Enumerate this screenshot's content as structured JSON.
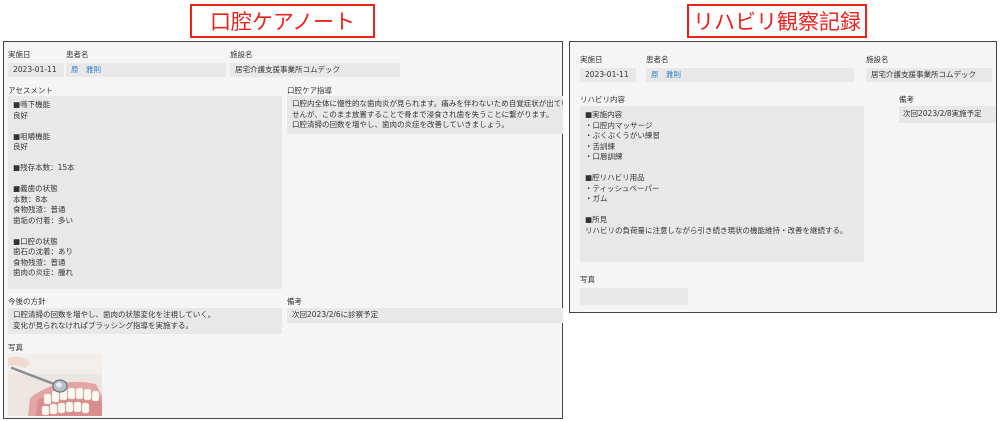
{
  "left": {
    "title": "口腔ケアノート",
    "date_label": "実施日",
    "date_value": "2023-01-11",
    "patient_label": "患者名",
    "patient_value": "原　雅則",
    "facility_label": "施設名",
    "facility_value": "居宅介護支援事業所コムデック",
    "assessment_label": "アセスメント",
    "assessment_lines": [
      "■嚥下機能",
      "良好",
      "",
      "■咀嚼機能",
      "良好",
      "",
      "■残存本数：15本",
      "",
      "■義歯の状態",
      "本数：8本",
      "食物残渣：普通",
      "歯垢の付着：多い",
      "",
      "■口腔の状態",
      "歯石の沈着：あり",
      "食物残渣：普通",
      "歯肉の炎症：腫れ"
    ],
    "guidance_label": "口腔ケア指導",
    "guidance_lines": [
      "口腔内全体に慢性的な歯肉炎が見られます。痛みを伴わないため自覚症状が出ていま",
      "せんが、このまま放置することで骨まで浸食され歯を失うことに繋がります。",
      "口腔清掃の回数を増やし、歯肉の炎症を改善していきましょう。"
    ],
    "policy_label": "今後の方針",
    "policy_lines": [
      "口腔清掃の回数を増やし、歯肉の状態変化を注視していく。",
      "変化が見られなければブラッシング指導を実施する。"
    ],
    "remarks_label": "備考",
    "remarks_value": "次回2023/2/6に診察予定",
    "photo_label": "写真"
  },
  "right": {
    "title": "リハビリ観察記録",
    "date_label": "実施日",
    "date_value": "2023-01-11",
    "patient_label": "患者名",
    "patient_value": "原　雅則",
    "facility_label": "施設名",
    "facility_value": "居宅介護支援事業所コムデック",
    "rehab_label": "リハビリ内容",
    "rehab_lines": [
      "■実施内容",
      "・口腔内マッサージ",
      "・ぶくぶくうがい練習",
      "・舌訓練",
      "・口唇訓練",
      "",
      "■腔リハビリ用品",
      "・ティッシュペーパー",
      "・ガム",
      "",
      "■所見",
      "リハビリの負荷量に注意しながら引き続き現状の機能維持・改善を継続する。"
    ],
    "remarks_label": "備考",
    "remarks_value": "次回2023/2/8実施予定",
    "photo_label": "写真"
  },
  "colors": {
    "title_red": "#e8231e",
    "link_blue": "#2f7fd1",
    "field_gray": "#e8e8e8",
    "panel_gray": "#f5f5f5"
  }
}
